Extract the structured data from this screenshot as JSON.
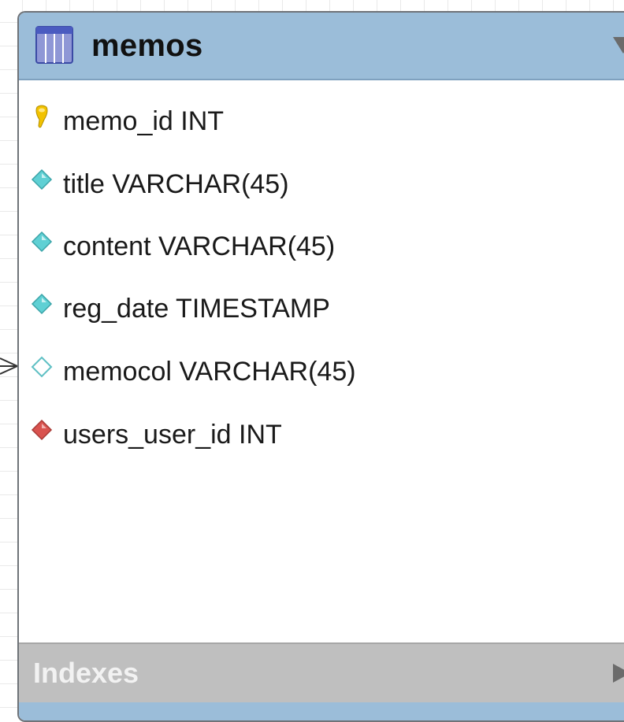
{
  "table": {
    "name": "memos",
    "icon": "table-icon",
    "collapse_icon": "triangle-down-icon",
    "header_color": "#9bbdd9"
  },
  "columns": [
    {
      "text": "memo_id INT",
      "kind": "primary-key",
      "icon": "key-icon",
      "color": "#f2c200"
    },
    {
      "text": "title VARCHAR(45)",
      "kind": "not-null",
      "icon": "diamond-filled-icon",
      "color": "#5fd0d4"
    },
    {
      "text": "content VARCHAR(45)",
      "kind": "not-null",
      "icon": "diamond-filled-icon",
      "color": "#5fd0d4"
    },
    {
      "text": "reg_date TIMESTAMP",
      "kind": "not-null",
      "icon": "diamond-filled-icon",
      "color": "#5fd0d4"
    },
    {
      "text": "memocol VARCHAR(45)",
      "kind": "nullable",
      "icon": "diamond-outline-icon",
      "color": "#5fd0d4"
    },
    {
      "text": "users_user_id INT",
      "kind": "foreign-key",
      "icon": "diamond-red-icon",
      "color": "#d9534f"
    }
  ],
  "indexes": {
    "label": "Indexes",
    "icon": "triangle-right-icon"
  }
}
